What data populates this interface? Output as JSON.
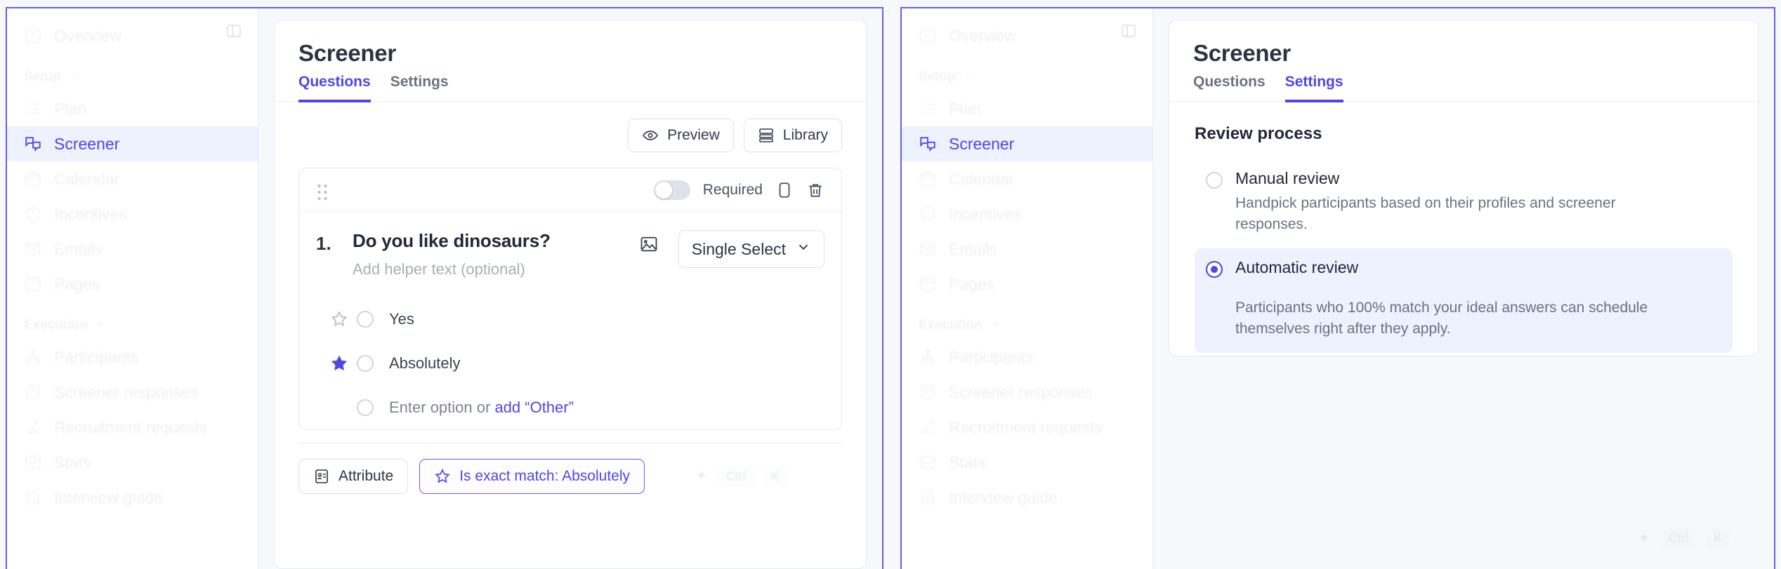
{
  "sidebar": {
    "items_top": [
      {
        "label": "Overview",
        "icon": "overview-icon"
      }
    ],
    "group_setup": {
      "label": "Setup",
      "chevron": "chevron-down-icon"
    },
    "items_setup": [
      {
        "label": "Plan",
        "icon": "plan-icon"
      },
      {
        "label": "Screener",
        "icon": "screener-icon",
        "active": true
      },
      {
        "label": "Calendar",
        "icon": "calendar-icon"
      },
      {
        "label": "Incentives",
        "icon": "incentives-icon"
      },
      {
        "label": "Emails",
        "icon": "emails-icon"
      },
      {
        "label": "Pages",
        "icon": "pages-icon"
      }
    ],
    "group_execution": {
      "label": "Execution",
      "chevron": "chevron-down-icon"
    },
    "items_execution": [
      {
        "label": "Participants",
        "icon": "participants-icon"
      },
      {
        "label": "Screener responses",
        "icon": "screener-responses-icon"
      },
      {
        "label": "Recruitment requests",
        "icon": "recruitment-requests-icon"
      },
      {
        "label": "Stats",
        "icon": "stats-icon"
      },
      {
        "label": "Interview guide",
        "icon": "interview-guide-icon"
      }
    ],
    "collapse_icon": "panel-collapse-icon"
  },
  "left_panel": {
    "title": "Screener",
    "tabs": [
      {
        "label": "Questions",
        "selected": true
      },
      {
        "label": "Settings",
        "selected": false
      }
    ],
    "toolbar": {
      "preview_label": "Preview",
      "preview_icon": "eye-icon",
      "library_label": "Library",
      "library_icon": "library-icon"
    },
    "question_header": {
      "drag_icon": "drag-handle-icon",
      "required_label": "Required",
      "required_on": false,
      "duplicate_icon": "duplicate-icon",
      "delete_icon": "trash-icon"
    },
    "question": {
      "number": "1.",
      "title": "Do you like dinosaurs?",
      "helper_placeholder": "Add helper text (optional)",
      "image_icon": "image-icon",
      "type_label": "Single Select",
      "type_chevron": "chevron-down-icon",
      "options": [
        {
          "label": "Yes",
          "star": "star-outline-icon",
          "starred": false,
          "placeholder": false
        },
        {
          "label": "Absolutely",
          "star": "star-filled-icon",
          "starred": true,
          "placeholder": false
        }
      ],
      "new_option": {
        "text": "Enter option or ",
        "link": "add “Other”",
        "placeholder": true
      }
    },
    "footer": {
      "attribute_label": "Attribute",
      "attribute_icon": "attribute-badge-icon",
      "match_label": "Is exact match: Absolutely",
      "match_icon": "star-outline-icon",
      "shortcut_spark": "sparkle-icon",
      "shortcut_ctrl": "Ctrl",
      "shortcut_key": "K"
    }
  },
  "right_panel": {
    "title": "Screener",
    "tabs": [
      {
        "label": "Questions",
        "selected": false
      },
      {
        "label": "Settings",
        "selected": true
      }
    ],
    "settings": {
      "section_title": "Review process",
      "options": [
        {
          "label": "Manual review",
          "description": "Handpick participants based on their profiles and screener responses.",
          "selected": false
        },
        {
          "label": "Automatic review",
          "description": "Participants who 100% match your ideal answers can schedule themselves right after they apply.",
          "selected": true
        }
      ]
    },
    "footer": {
      "shortcut_spark": "sparkle-icon",
      "shortcut_ctrl": "Ctrl",
      "shortcut_key": "K"
    }
  },
  "colors": {
    "accent": "#5046e5",
    "accent_soft": "#eef1fe",
    "panel_border": "#6b5ce7",
    "page_bg": "#f7f8fb"
  }
}
